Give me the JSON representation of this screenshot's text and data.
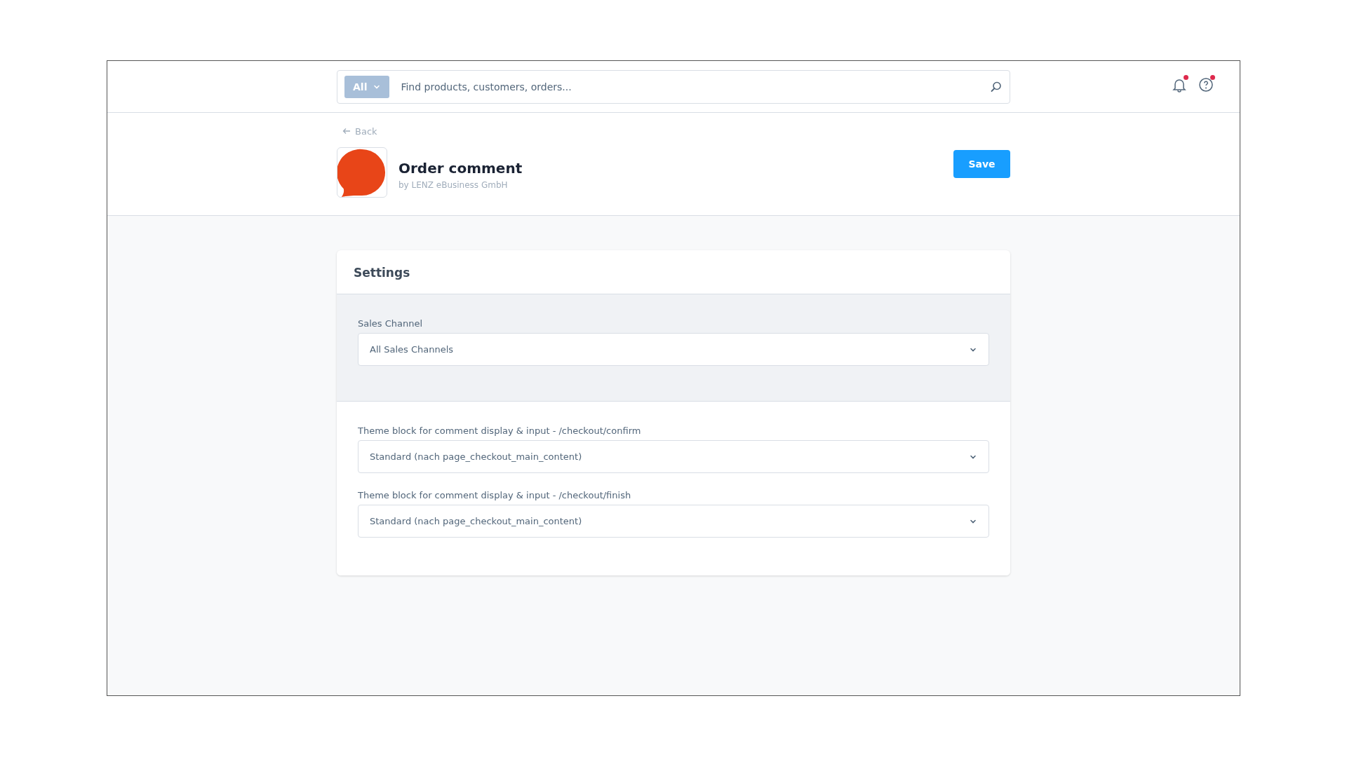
{
  "search": {
    "scope": "All",
    "placeholder": "Find products, customers, orders..."
  },
  "header_icons": [
    {
      "kind": "bell",
      "badge": true
    },
    {
      "kind": "help",
      "badge": true
    }
  ],
  "back_link": "Back",
  "extension": {
    "name": "Order comment",
    "vendor": "by LENZ eBusiness GmbH"
  },
  "save_button": "Save",
  "card": {
    "title": "Settings",
    "sections": [
      {
        "shaded": true,
        "fields": [
          {
            "label": "Sales Channel",
            "value": "All Sales Channels"
          }
        ]
      },
      {
        "shaded": false,
        "fields": [
          {
            "label": "Theme block for comment display & input - /checkout/confirm",
            "value": "Standard (nach page_checkout_main_content)"
          },
          {
            "label": "Theme block for comment display & input - /checkout/finish",
            "value": "Standard (nach page_checkout_main_content)"
          }
        ]
      }
    ]
  }
}
